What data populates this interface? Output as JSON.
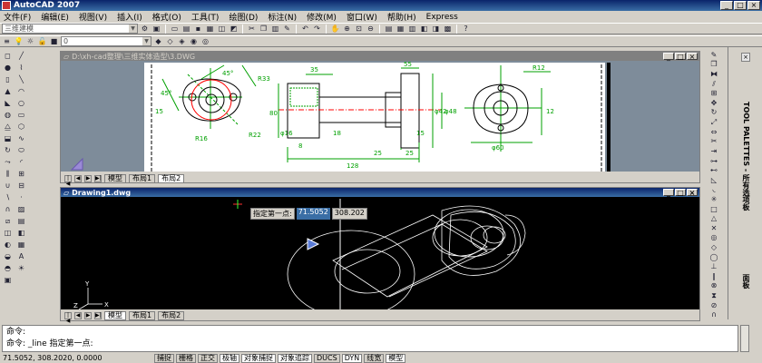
{
  "window": {
    "title": "AutoCAD 2007",
    "controls": [
      "_",
      "□",
      "×"
    ]
  },
  "menu": [
    "文件(F)",
    "编辑(E)",
    "视图(V)",
    "插入(I)",
    "格式(O)",
    "工具(T)",
    "绘图(D)",
    "标注(N)",
    "修改(M)",
    "窗口(W)",
    "帮助(H)",
    "Express"
  ],
  "toolbar": {
    "workspace_combo": "三维建模",
    "layer_combo": "0"
  },
  "doc1": {
    "title": "D:\\xh-cad整理\\三维实体造型\\3.DWG",
    "tabs": [
      "模型",
      "布局1",
      "布局2"
    ],
    "active_tab": 2,
    "labels": [
      "45°",
      "45°",
      "R33",
      "15",
      "R16",
      "R22",
      "35",
      "55",
      "80",
      "25",
      "8",
      "R12",
      "12",
      "128",
      "25",
      "18",
      "15",
      "φ42",
      "φ48",
      "φ60",
      "φ16"
    ]
  },
  "doc2": {
    "title": "Drawing1.dwg",
    "tabs": [
      "模型",
      "布局1",
      "布局2"
    ],
    "active_tab": 0,
    "prompt_label": "指定第一点:",
    "coord_x": "71.5052",
    "coord_y": "308.202",
    "axis_x": "X",
    "axis_y": "Y",
    "axis_z": "Z"
  },
  "command": {
    "line1": "命令:",
    "line2": "命令:  _line 指定第一点:"
  },
  "status": {
    "coords": "71.5052,  308.2020, 0.0000",
    "buttons": [
      "捕捉",
      "栅格",
      "正交",
      "极轴",
      "对象捕捉",
      "对象追踪",
      "DUCS",
      "DYN",
      "线宽",
      "模型"
    ],
    "active": [
      "极轴",
      "对象捕捉",
      "对象追踪",
      "DYN",
      "模型"
    ]
  },
  "palette": {
    "title": "TOOL PALETTES - 所有选项板",
    "footer": "面板"
  },
  "colors": {
    "accent": "#0a246a",
    "model_bg": "#000000",
    "paper_bg": "#ffffff",
    "dim_green": "#00c000",
    "part_red": "#ff0000"
  }
}
